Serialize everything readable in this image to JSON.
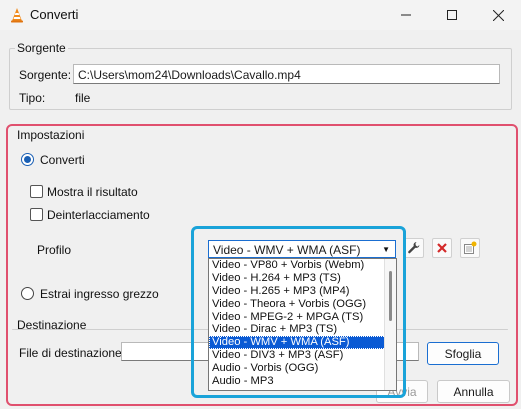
{
  "window": {
    "title": "Converti"
  },
  "source": {
    "group_title": "Sorgente",
    "source_label": "Sorgente:",
    "source_value": "C:\\Users\\mom24\\Downloads\\Cavallo.mp4",
    "type_label": "Tipo:",
    "type_value": "file"
  },
  "settings": {
    "group_title": "Impostazioni",
    "convert_label": "Converti",
    "show_result_label": "Mostra il risultato",
    "deinterlace_label": "Deinterlacciamento",
    "profile_label": "Profilo",
    "profile_selected": "Video - WMV + WMA (ASF)",
    "raw_input_label": "Estrai ingresso grezzo",
    "profile_options": [
      "Video - VP80 + Vorbis (Webm)",
      "Video - H.264 + MP3 (TS)",
      "Video - H.265 + MP3 (MP4)",
      "Video - Theora + Vorbis (OGG)",
      "Video - MPEG-2 + MPGA (TS)",
      "Video - Dirac + MP3 (TS)",
      "Video - WMV + WMA (ASF)",
      "Video - DIV3 + MP3 (ASF)",
      "Audio - Vorbis (OGG)",
      "Audio - MP3"
    ]
  },
  "destination": {
    "group_title": "Destinazione",
    "file_label": "File di destinazione:",
    "file_value": "",
    "browse_label": "Sfoglia"
  },
  "footer": {
    "start_label": "Avvia",
    "cancel_label": "Annulla"
  },
  "colors": {
    "highlight_red": "#e0506e",
    "highlight_blue": "#1aa3d9",
    "selection": "#0a5ad4"
  }
}
